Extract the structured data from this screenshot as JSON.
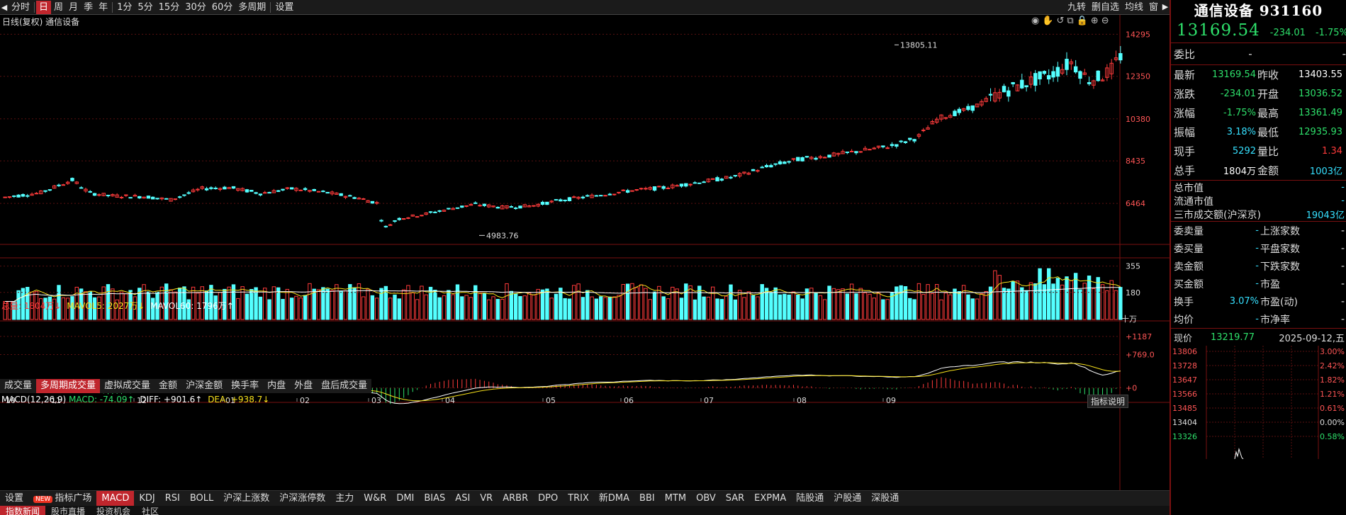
{
  "toolbar": {
    "left_buttons": [
      "分时",
      "日",
      "周",
      "月",
      "季",
      "年",
      "1分",
      "5分",
      "15分",
      "30分",
      "60分",
      "多周期",
      "设置"
    ],
    "active": "日",
    "right_buttons": [
      "九转",
      "删自选",
      "均线",
      "窗"
    ]
  },
  "chart": {
    "title": "日线(复权) 通信设备",
    "price_ticks": [
      "14295",
      "12350",
      "10380",
      "8435",
      "6464"
    ],
    "high_label": "13805.11",
    "low_label": "4983.76",
    "month_labels": [
      "10",
      "11",
      "12",
      "01",
      "02",
      "03",
      "04",
      "05",
      "06",
      "07",
      "08",
      "09"
    ],
    "colors": {
      "up": "#ff3b3b",
      "down": "#54ffff",
      "ma_white": "#ffffff",
      "ma_yellow": "#f7e11b",
      "bg": "#000000",
      "grid": "#5a1010"
    }
  },
  "volume": {
    "header": {
      "total": "总量: 1804万↓",
      "mavol5": "MAVOL5: 2027万↓",
      "mavol60": "MAVOL60: 1796万↑"
    },
    "ticks": [
      "355",
      "180"
    ],
    "unit": "十万",
    "tabs": [
      "成交量",
      "多周期成交量",
      "虚拟成交量",
      "金额",
      "沪深金额",
      "换手率",
      "内盘",
      "外盘",
      "盘后成交量"
    ],
    "active_tab": "多周期成交量"
  },
  "macd": {
    "header": {
      "name": "MACD(12,26,9)",
      "macd": "MACD: -74.09↑",
      "diff": "DIFF: +901.6↑",
      "dea": "DEA: +938.7↓"
    },
    "ticks": [
      "+1187",
      "+769.0",
      "+0"
    ],
    "explain_button": "指标说明"
  },
  "bottom_tabs": {
    "items": [
      "设置",
      "指标广场",
      "MACD",
      "KDJ",
      "RSI",
      "BOLL",
      "沪深上涨数",
      "沪深涨停数",
      "主力",
      "W&R",
      "DMI",
      "BIAS",
      "ASI",
      "VR",
      "ARBR",
      "DPO",
      "TRIX",
      "新DMA",
      "BBI",
      "MTM",
      "OBV",
      "SAR",
      "EXPMA",
      "陆股通",
      "沪股通",
      "深股通"
    ],
    "active": "MACD",
    "new_badge": "NEW"
  },
  "news_tabs": {
    "items": [
      "指数新闻",
      "股市直播",
      "投资机会",
      "社区"
    ],
    "active": "指数新闻"
  },
  "quote": {
    "name": "通信设备 931160",
    "price": "13169.54",
    "change": "-234.01",
    "pct": "-1.75%",
    "weibi_label": "委比",
    "weibi_val": "-",
    "weibi_val2": "-",
    "rows": [
      {
        "l1": "最新",
        "v1": "13169.54",
        "c1": "green",
        "l2": "昨收",
        "v2": "13403.55",
        "c2": "white"
      },
      {
        "l1": "涨跌",
        "v1": "-234.01",
        "c1": "green",
        "l2": "开盘",
        "v2": "13036.52",
        "c2": "green"
      },
      {
        "l1": "涨幅",
        "v1": "-1.75%",
        "c1": "green",
        "l2": "最高",
        "v2": "13361.49",
        "c2": "green"
      },
      {
        "l1": "振幅",
        "v1": "3.18%",
        "c1": "cyan",
        "l2": "最低",
        "v2": "12935.93",
        "c2": "green"
      },
      {
        "l1": "现手",
        "v1": "5292",
        "c1": "cyan",
        "l2": "量比",
        "v2": "1.34",
        "c2": "red"
      },
      {
        "l1": "总手",
        "v1": "1804万",
        "c1": "white",
        "l2": "金额",
        "v2": "1003亿",
        "c2": "cyan"
      }
    ],
    "mkt_rows": [
      {
        "l": "总市值",
        "v": "-",
        "c": "cyan"
      },
      {
        "l": "流通市值",
        "v": "-",
        "c": "cyan"
      },
      {
        "l": "三市成交额(沪深京)",
        "v": "19043亿",
        "c": "cyan"
      }
    ],
    "breadth": [
      {
        "l1": "委卖量",
        "v1": "-",
        "l2": "上涨家数",
        "v2": "-"
      },
      {
        "l1": "委买量",
        "v1": "-",
        "l2": "平盘家数",
        "v2": "-"
      },
      {
        "l1": "卖金额",
        "v1": "-",
        "l2": "下跌家数",
        "v2": "-"
      },
      {
        "l1": "买金额",
        "v1": "-",
        "l2": "市盈",
        "v2": "-"
      },
      {
        "l1": "换手",
        "v1": "3.07%",
        "l2": "市盈(动)",
        "v2": "-"
      },
      {
        "l1": "均价",
        "v1": "-",
        "l2": "市净率",
        "v2": "-"
      }
    ],
    "mini": {
      "now_label": "现价",
      "now_val": "13219.77",
      "date": "2025-09-12,五",
      "left_ticks": [
        "13806",
        "13728",
        "13647",
        "13566",
        "13485",
        "13404",
        "13326"
      ],
      "right_ticks": [
        "3.00%",
        "2.42%",
        "1.82%",
        "1.21%",
        "0.61%",
        "0.00%",
        "0.58%"
      ]
    }
  }
}
